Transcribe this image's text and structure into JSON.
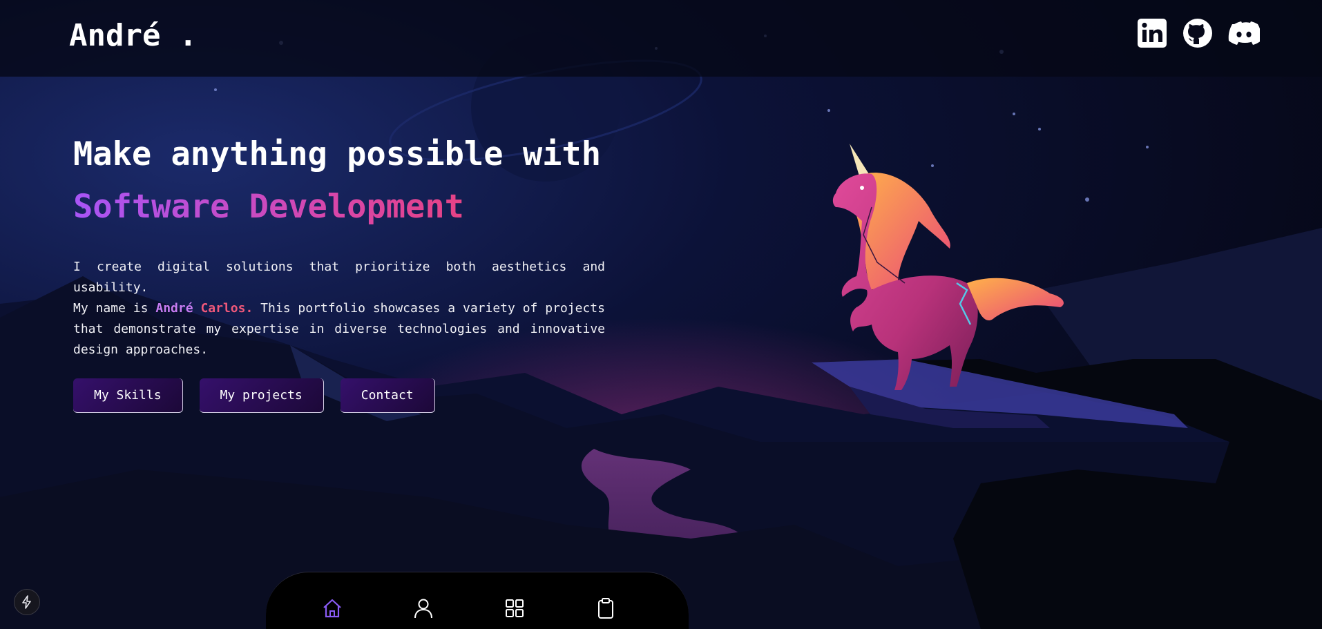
{
  "header": {
    "logo": "André .",
    "socials": [
      {
        "icon": "linkedin-icon"
      },
      {
        "icon": "github-icon"
      },
      {
        "icon": "discord-icon"
      }
    ]
  },
  "hero": {
    "title_line1": "Make anything possible with",
    "title_line2": "Software Development",
    "desc_line1": "I create digital solutions that prioritize both aesthetics and usability.",
    "desc_prefix": "My name is ",
    "name_first": "André",
    "name_last": "Carlos.",
    "desc_suffix": " This portfolio showcases a variety of projects that demonstrate my expertise in diverse technologies and innovative design approaches.",
    "buttons": {
      "skills": "My Skills",
      "projects": "My projects",
      "contact": "Contact"
    }
  },
  "dock": {
    "items": [
      {
        "icon": "home-icon",
        "active": true
      },
      {
        "icon": "user-icon",
        "active": false
      },
      {
        "icon": "grid-icon",
        "active": false
      },
      {
        "icon": "clipboard-icon",
        "active": false
      }
    ]
  },
  "colors": {
    "accent_purple": "#a855f7",
    "accent_pink": "#f43f5e",
    "dock_active": "#8b5cf6",
    "button_bg": "#35106b"
  }
}
